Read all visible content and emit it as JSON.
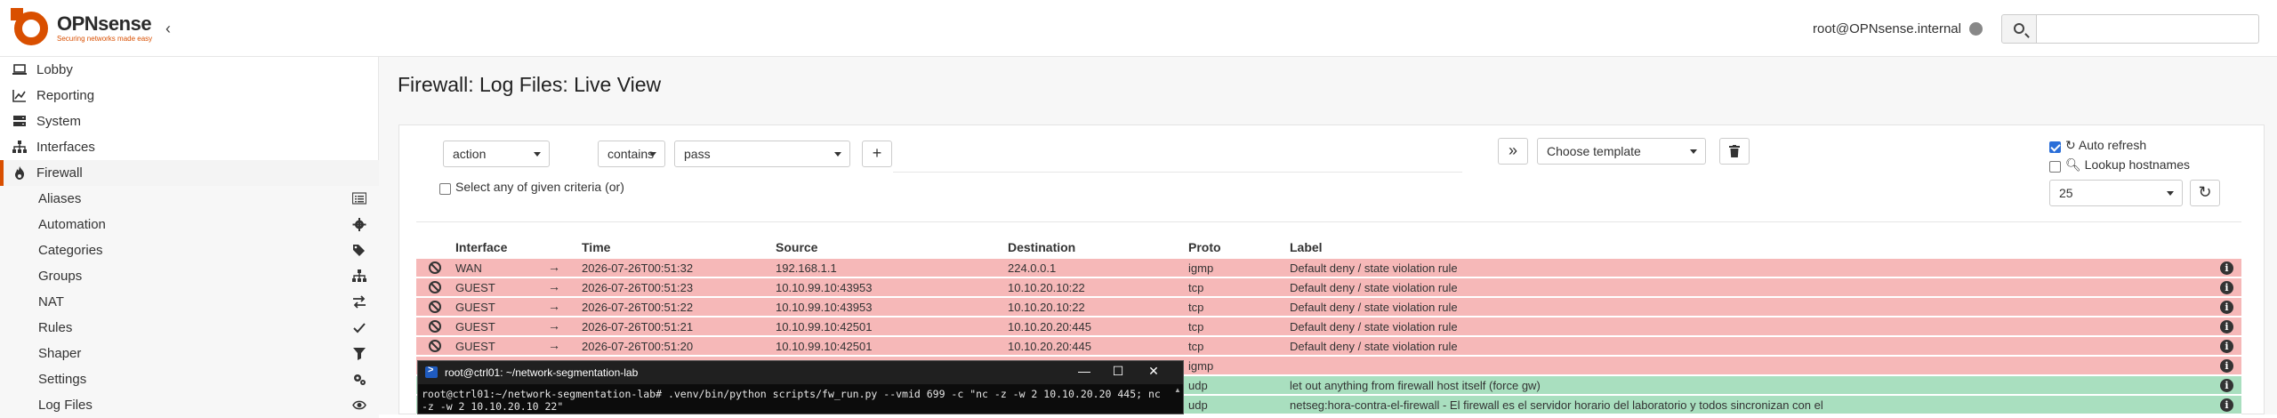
{
  "header": {
    "brand": "OPNsense",
    "tagline": "Securing networks made easy",
    "user": "root@OPNsense.internal",
    "search_placeholder": ""
  },
  "sidebar": {
    "items": [
      {
        "label": "Lobby",
        "icon": "laptop-icon"
      },
      {
        "label": "Reporting",
        "icon": "chart-icon"
      },
      {
        "label": "System",
        "icon": "server-icon"
      },
      {
        "label": "Interfaces",
        "icon": "sitemap-icon"
      },
      {
        "label": "Firewall",
        "icon": "fire-icon",
        "active": true
      }
    ],
    "firewall_sub": [
      {
        "label": "Aliases",
        "icon": "list-icon"
      },
      {
        "label": "Automation",
        "icon": "gear-icon"
      },
      {
        "label": "Categories",
        "icon": "tags-icon"
      },
      {
        "label": "Groups",
        "icon": "sitemap-icon"
      },
      {
        "label": "NAT",
        "icon": "exchange-icon"
      },
      {
        "label": "Rules",
        "icon": "check-icon"
      },
      {
        "label": "Shaper",
        "icon": "filter-icon"
      },
      {
        "label": "Settings",
        "icon": "cogs-icon"
      },
      {
        "label": "Log Files",
        "icon": "eye-icon"
      }
    ]
  },
  "page": {
    "title": "Firewall: Log Files: Live View"
  },
  "filter": {
    "field": "action",
    "operator": "contains",
    "value": "pass",
    "any_criteria_label": "Select any of given criteria (or)",
    "template_placeholder": "Choose template",
    "auto_refresh_label": "Auto refresh",
    "lookup_hostnames_label": "Lookup hostnames",
    "page_size": "25"
  },
  "table": {
    "headers": [
      "Interface",
      "Time",
      "Source",
      "Destination",
      "Proto",
      "Label"
    ],
    "rows": [
      {
        "status": "block",
        "interface": "WAN",
        "time": "2026-07-26T00:51:32",
        "source": "192.168.1.1",
        "destination": "224.0.0.1",
        "proto": "igmp",
        "label": "Default deny / state violation rule"
      },
      {
        "status": "block",
        "interface": "GUEST",
        "time": "2026-07-26T00:51:23",
        "source": "10.10.99.10:43953",
        "destination": "10.10.20.10:22",
        "proto": "tcp",
        "label": "Default deny / state violation rule"
      },
      {
        "status": "block",
        "interface": "GUEST",
        "time": "2026-07-26T00:51:22",
        "source": "10.10.99.10:43953",
        "destination": "10.10.20.10:22",
        "proto": "tcp",
        "label": "Default deny / state violation rule"
      },
      {
        "status": "block",
        "interface": "GUEST",
        "time": "2026-07-26T00:51:21",
        "source": "10.10.99.10:42501",
        "destination": "10.10.20.20:445",
        "proto": "tcp",
        "label": "Default deny / state violation rule"
      },
      {
        "status": "block",
        "interface": "GUEST",
        "time": "2026-07-26T00:51:20",
        "source": "10.10.99.10:42501",
        "destination": "10.10.20.20:445",
        "proto": "tcp",
        "label": "Default deny / state violation rule"
      },
      {
        "status": "block",
        "interface": "",
        "time": "",
        "source": "",
        "destination": "",
        "proto": "igmp",
        "label": ""
      },
      {
        "status": "pass",
        "interface": "",
        "time": "",
        "source": "",
        "destination": "",
        "proto": "udp",
        "label": "let out anything from firewall host itself (force gw)"
      },
      {
        "status": "pass",
        "interface": "",
        "time": "",
        "source": "",
        "destination": "",
        "proto": "udp",
        "label": "netseg:hora-contra-el-firewall - El firewall es el servidor horario del laboratorio y todos sincronizan con el"
      }
    ]
  },
  "terminal": {
    "title": "root@ctrl01: ~/network-segmentation-lab",
    "line": "root@ctrl01:~/network-segmentation-lab# .venv/bin/python scripts/fw_run.py --vmid 699 -c \"nc -z -w 2 10.10.20.20 445; nc -z -w 2 10.10.20.10 22\"",
    "minimize": "—",
    "maximize": "☐",
    "close": "✕"
  }
}
